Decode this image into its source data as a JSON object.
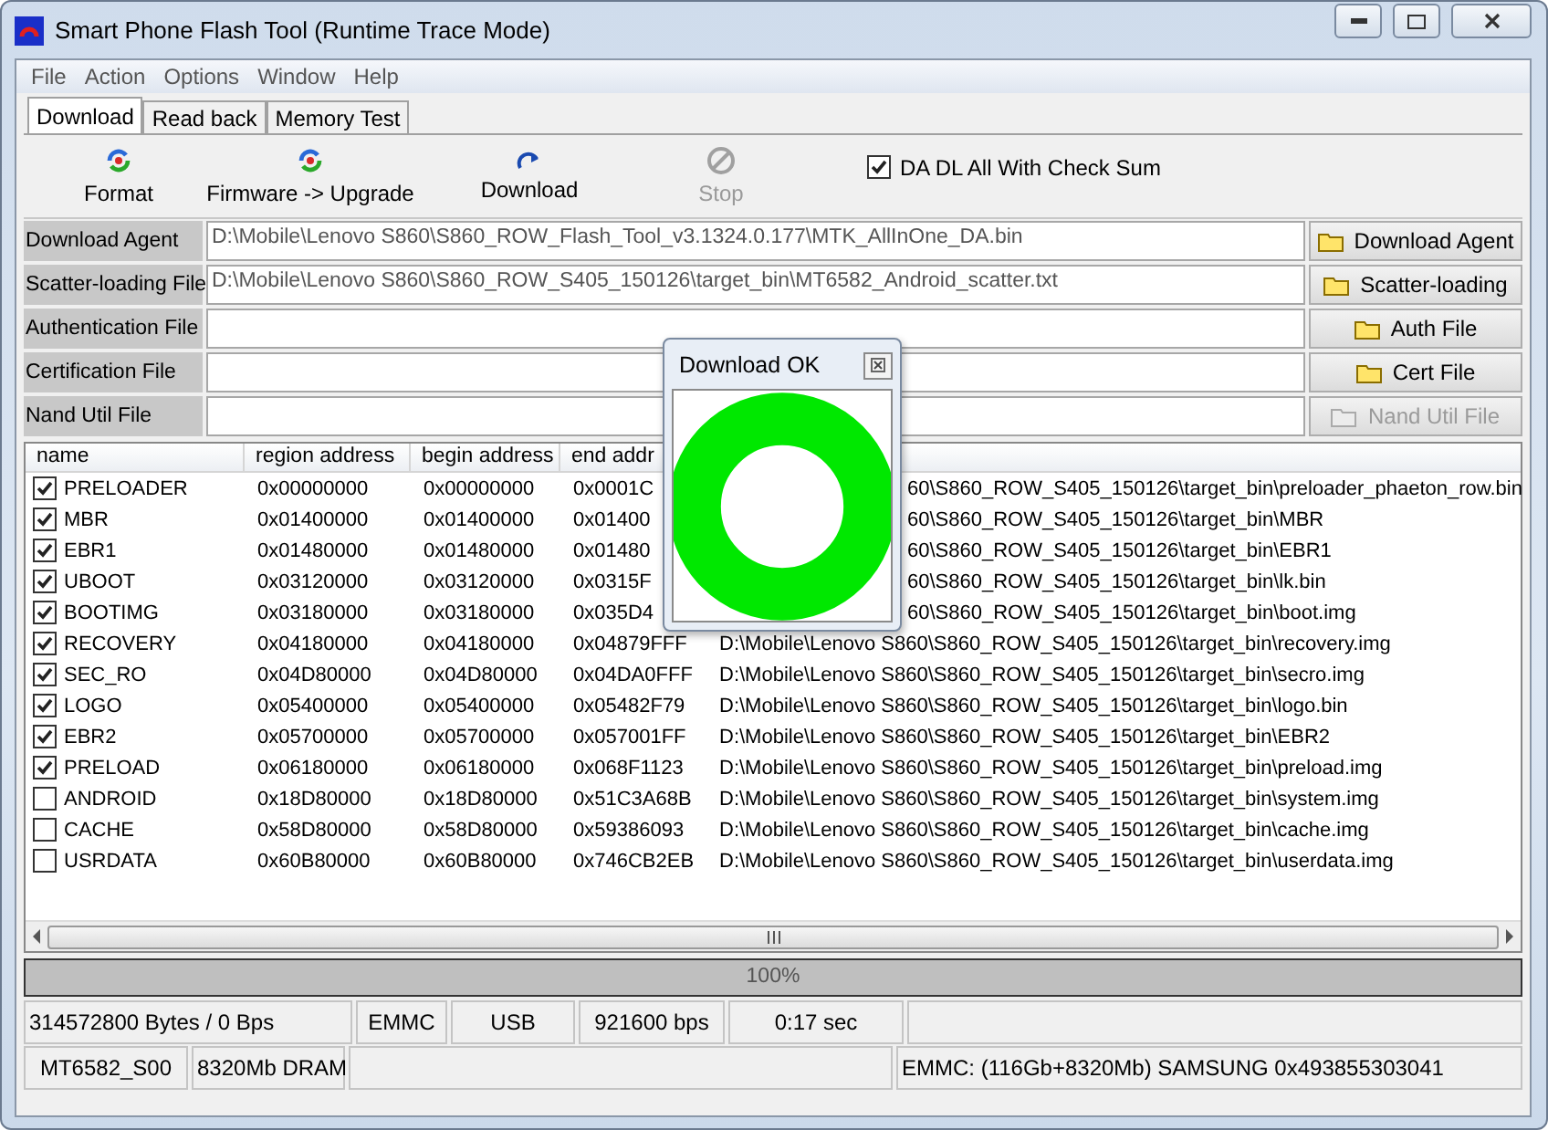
{
  "window": {
    "title": "Smart Phone Flash Tool (Runtime Trace Mode)"
  },
  "menu": [
    "File",
    "Action",
    "Options",
    "Window",
    "Help"
  ],
  "tabs": [
    {
      "label": "Download",
      "selected": true
    },
    {
      "label": "Read back",
      "selected": false
    },
    {
      "label": "Memory Test",
      "selected": false
    }
  ],
  "toolbar": [
    {
      "kind": "format",
      "label": "Format",
      "disabled": false
    },
    {
      "kind": "upgrade",
      "label": "Firmware -> Upgrade",
      "disabled": false
    },
    {
      "kind": "download",
      "label": "Download",
      "disabled": false
    },
    {
      "kind": "stop",
      "label": "Stop",
      "disabled": true
    }
  ],
  "checksum": {
    "label": "DA DL All With Check Sum",
    "checked": true
  },
  "files": [
    {
      "label": "Download Agent",
      "value": "D:\\Mobile\\Lenovo S860\\S860_ROW_Flash_Tool_v3.1324.0.177\\MTK_AllInOne_DA.bin",
      "button": "Download Agent",
      "disabled": false
    },
    {
      "label": "Scatter-loading File",
      "value": "D:\\Mobile\\Lenovo S860\\S860_ROW_S405_150126\\target_bin\\MT6582_Android_scatter.txt",
      "button": "Scatter-loading",
      "disabled": false
    },
    {
      "label": "Authentication File",
      "button": "Auth File",
      "disabled": false
    },
    {
      "label": "Certification File",
      "button": "Cert File",
      "disabled": false
    },
    {
      "label": "Nand Util File",
      "button": "Nand Util File",
      "disabled": true
    }
  ],
  "table": {
    "columns": [
      "name",
      "region address",
      "begin address",
      "end addr"
    ],
    "rows": [
      {
        "kind": "covered",
        "checked": true,
        "name": "PRELOADER",
        "region": "0x00000000",
        "begin": "0x00000000",
        "end": "0x0001C",
        "location": "60\\S860_ROW_S405_150126\\target_bin\\preloader_phaeton_row.bin"
      },
      {
        "kind": "covered",
        "checked": true,
        "name": "MBR",
        "region": "0x01400000",
        "begin": "0x01400000",
        "end": "0x01400",
        "location": "60\\S860_ROW_S405_150126\\target_bin\\MBR"
      },
      {
        "kind": "covered",
        "checked": true,
        "name": "EBR1",
        "region": "0x01480000",
        "begin": "0x01480000",
        "end": "0x01480",
        "location": "60\\S860_ROW_S405_150126\\target_bin\\EBR1"
      },
      {
        "kind": "covered",
        "checked": true,
        "name": "UBOOT",
        "region": "0x03120000",
        "begin": "0x03120000",
        "end": "0x0315F",
        "location": "60\\S860_ROW_S405_150126\\target_bin\\lk.bin"
      },
      {
        "kind": "covered",
        "checked": true,
        "name": "BOOTIMG",
        "region": "0x03180000",
        "begin": "0x03180000",
        "end": "0x035D4",
        "location": "60\\S860_ROW_S405_150126\\target_bin\\boot.img"
      },
      {
        "kind": "full",
        "checked": true,
        "name": "RECOVERY",
        "region": "0x04180000",
        "begin": "0x04180000",
        "end": "0x04879FFF",
        "location": "D:\\Mobile\\Lenovo S860\\S860_ROW_S405_150126\\target_bin\\recovery.img"
      },
      {
        "kind": "full",
        "checked": true,
        "name": "SEC_RO",
        "region": "0x04D80000",
        "begin": "0x04D80000",
        "end": "0x04DA0FFF",
        "location": "D:\\Mobile\\Lenovo S860\\S860_ROW_S405_150126\\target_bin\\secro.img"
      },
      {
        "kind": "full",
        "checked": true,
        "name": "LOGO",
        "region": "0x05400000",
        "begin": "0x05400000",
        "end": "0x05482F79",
        "location": "D:\\Mobile\\Lenovo S860\\S860_ROW_S405_150126\\target_bin\\logo.bin"
      },
      {
        "kind": "full",
        "checked": true,
        "name": "EBR2",
        "region": "0x05700000",
        "begin": "0x05700000",
        "end": "0x057001FF",
        "location": "D:\\Mobile\\Lenovo S860\\S860_ROW_S405_150126\\target_bin\\EBR2"
      },
      {
        "kind": "full",
        "checked": true,
        "name": "PRELOAD",
        "region": "0x06180000",
        "begin": "0x06180000",
        "end": "0x068F1123",
        "location": "D:\\Mobile\\Lenovo S860\\S860_ROW_S405_150126\\target_bin\\preload.img"
      },
      {
        "kind": "full",
        "checked": false,
        "name": "ANDROID",
        "region": "0x18D80000",
        "begin": "0x18D80000",
        "end": "0x51C3A68B",
        "location": "D:\\Mobile\\Lenovo S860\\S860_ROW_S405_150126\\target_bin\\system.img"
      },
      {
        "kind": "full",
        "checked": false,
        "name": "CACHE",
        "region": "0x58D80000",
        "begin": "0x58D80000",
        "end": "0x59386093",
        "location": "D:\\Mobile\\Lenovo S860\\S860_ROW_S405_150126\\target_bin\\cache.img"
      },
      {
        "kind": "full",
        "checked": false,
        "name": "USRDATA",
        "region": "0x60B80000",
        "begin": "0x60B80000",
        "end": "0x746CB2EB",
        "location": "D:\\Mobile\\Lenovo S860\\S860_ROW_S405_150126\\target_bin\\userdata.img"
      }
    ]
  },
  "progress": {
    "label": "100%",
    "level": 1
  },
  "status_rows": [
    [
      "314572800 Bytes / 0 Bps",
      "EMMC",
      "USB",
      "921600 bps",
      "0:17 sec",
      ""
    ],
    [
      "MT6582_S00",
      "8320Mb DRAM",
      "",
      "EMMC: (116Gb+8320Mb) SAMSUNG 0x493855303041"
    ]
  ],
  "dialog": {
    "title": "Download OK"
  }
}
